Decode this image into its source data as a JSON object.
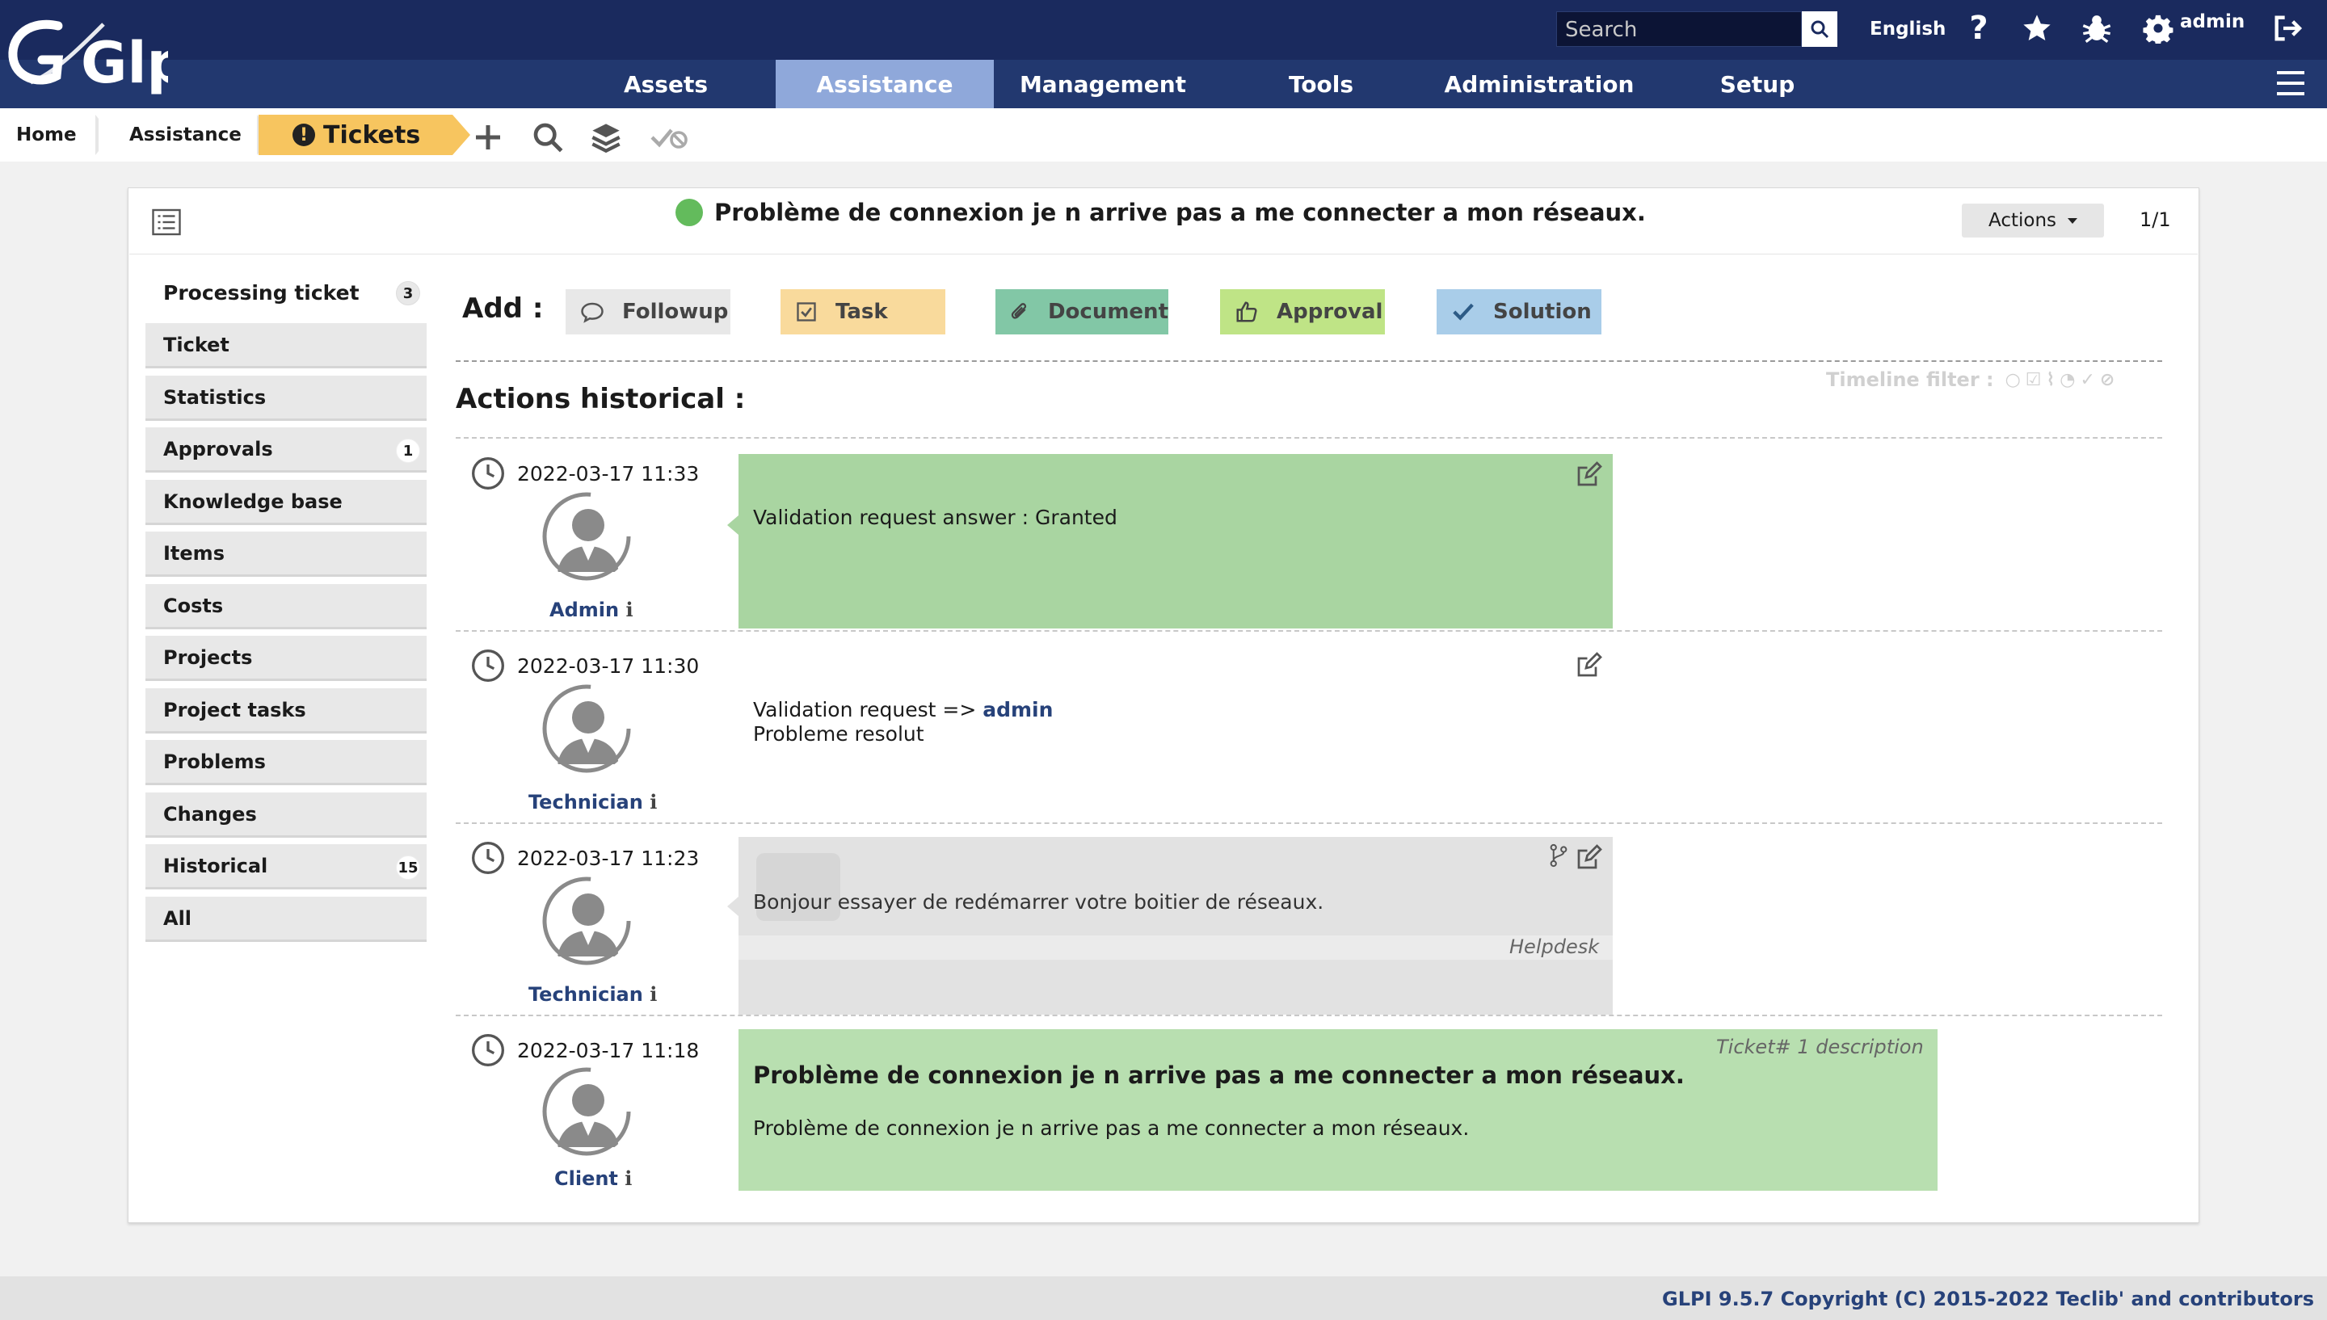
{
  "header": {
    "logo_text": "Glpi",
    "search_placeholder": "Search",
    "language": "English",
    "user": "admin",
    "nav": [
      "Assets",
      "Assistance",
      "Management",
      "Tools",
      "Administration",
      "Setup"
    ],
    "active_nav": "Assistance"
  },
  "breadcrumb": {
    "home": "Home",
    "section": "Assistance",
    "page": "Tickets"
  },
  "ticket": {
    "title": "Problème de connexion je n arrive pas a me connecter a mon réseaux.",
    "actions_label": "Actions",
    "pager": "1/1",
    "status_color": "#63bb5c"
  },
  "tabs": [
    {
      "label": "Processing ticket",
      "badge": "3"
    },
    {
      "label": "Ticket",
      "badge": ""
    },
    {
      "label": "Statistics",
      "badge": ""
    },
    {
      "label": "Approvals",
      "badge": "1"
    },
    {
      "label": "Knowledge base",
      "badge": ""
    },
    {
      "label": "Items",
      "badge": ""
    },
    {
      "label": "Costs",
      "badge": ""
    },
    {
      "label": "Projects",
      "badge": ""
    },
    {
      "label": "Project tasks",
      "badge": ""
    },
    {
      "label": "Problems",
      "badge": ""
    },
    {
      "label": "Changes",
      "badge": ""
    },
    {
      "label": "Historical",
      "badge": "15"
    },
    {
      "label": "All",
      "badge": ""
    }
  ],
  "add": {
    "label": "Add :",
    "buttons": [
      "Followup",
      "Task",
      "Document",
      "Approval",
      "Solution"
    ]
  },
  "history": {
    "title": "Actions historical :",
    "filter_label": "Timeline filter :",
    "items": [
      {
        "date": "2022-03-17 11:33",
        "author": "Admin",
        "text": "Validation request answer : Granted"
      },
      {
        "date": "2022-03-17 11:30",
        "author": "Technician",
        "text_prefix": "Validation request => ",
        "link": "admin",
        "text2": "Probleme resolut"
      },
      {
        "date": "2022-03-17 11:23",
        "author": "Technician",
        "text": "Bonjour essayer de redémarrer votre boitier de réseaux.",
        "source": "Helpdesk"
      },
      {
        "date": "2022-03-17 11:18",
        "author": "Client",
        "heading": "Problème de connexion je n arrive pas a me connecter a mon réseaux.",
        "text": "Problème de connexion je n arrive pas a me connecter a mon réseaux.",
        "tag": "Ticket# 1 description"
      }
    ]
  },
  "footer": "GLPI 9.5.7 Copyright (C) 2015-2022 Teclib' and contributors"
}
